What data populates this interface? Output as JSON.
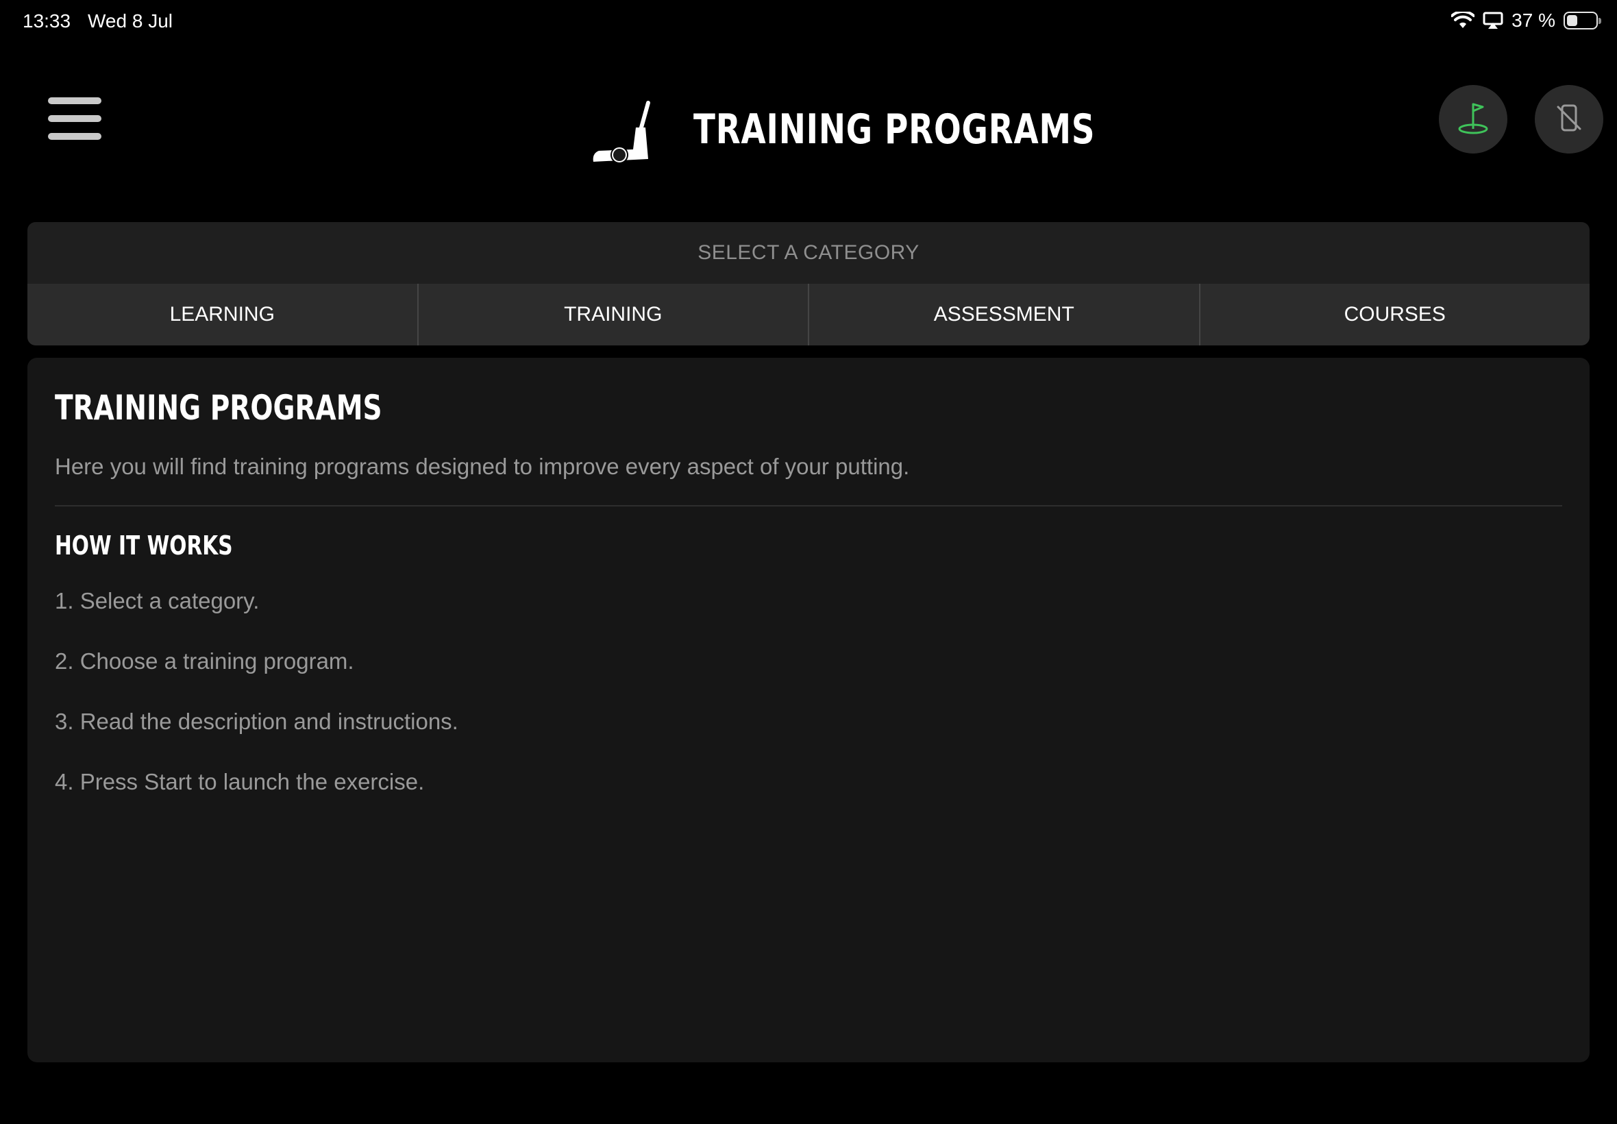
{
  "status_bar": {
    "time": "13:33",
    "date": "Wed 8 Jul",
    "battery_percent": "37 %",
    "battery_level": 0.37,
    "icons": [
      "wifi-icon",
      "airplay-icon",
      "battery-icon"
    ]
  },
  "header": {
    "title": "TRAINING PROGRAMS",
    "logo_icon": "putter-icon",
    "menu_icon": "hamburger-menu-icon",
    "right_buttons": [
      {
        "icon": "golf-flag-icon",
        "accent_color": "#3fc35a"
      },
      {
        "icon": "phone-disconnected-icon",
        "accent_color": "#9a9a9a"
      }
    ]
  },
  "category": {
    "label": "SELECT A CATEGORY",
    "tabs": [
      {
        "label": "LEARNING"
      },
      {
        "label": "TRAINING"
      },
      {
        "label": "ASSESSMENT"
      },
      {
        "label": "COURSES"
      }
    ]
  },
  "content": {
    "title": "TRAINING PROGRAMS",
    "description": "Here you will find training programs designed to improve every aspect of your putting.",
    "how_title": "HOW IT WORKS",
    "steps": [
      "1. Select a category.",
      "2. Choose a training program.",
      "3. Read the description and instructions.",
      "4. Press Start to launch the exercise."
    ]
  },
  "colors": {
    "background": "#000000",
    "card": "#161616",
    "tab_bg": "#2c2c2c",
    "accent_green": "#3fc35a",
    "text_primary": "#ffffff",
    "text_secondary": "#9a9a9a"
  }
}
